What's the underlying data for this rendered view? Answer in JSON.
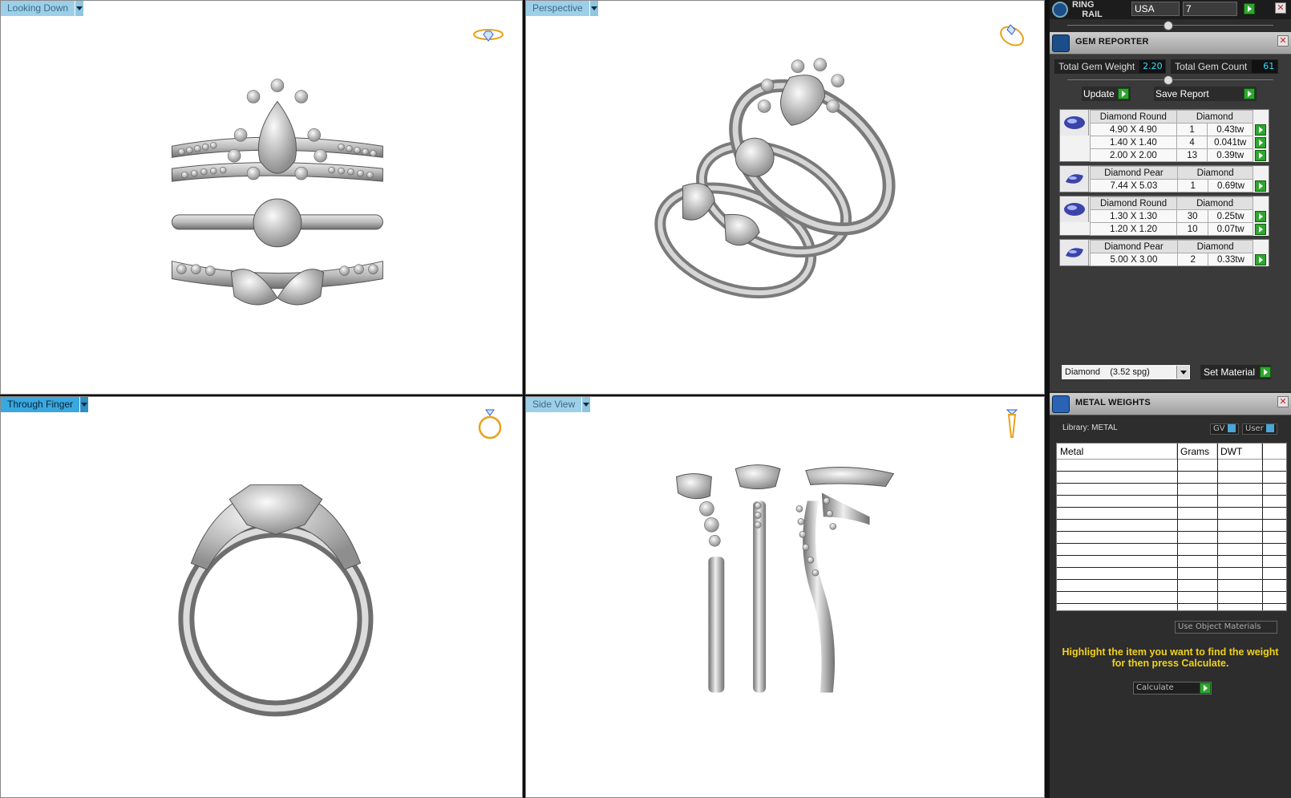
{
  "viewports": {
    "top_left": {
      "label": "Looking Down"
    },
    "top_right": {
      "label": "Perspective"
    },
    "bottom_left": {
      "label": "Through Finger"
    },
    "bottom_right": {
      "label": "Side View"
    }
  },
  "ring_rail": {
    "title_line1": "RING",
    "title_line2": "RAIL",
    "country": "USA",
    "size": "7"
  },
  "gem_reporter": {
    "title": "GEM REPORTER",
    "total_weight_label": "Total Gem Weight",
    "total_weight": "2.20",
    "total_count_label": "Total Gem Count",
    "total_count": "61",
    "update_label": "Update",
    "save_label": "Save Report",
    "groups": [
      {
        "shape": "Diamond Round",
        "material": "Diamond",
        "rows": [
          {
            "size": "4.90 X 4.90",
            "count": "1",
            "weight": "0.43tw"
          },
          {
            "size": "1.40 X 1.40",
            "count": "4",
            "weight": "0.041tw"
          },
          {
            "size": "2.00 X 2.00",
            "count": "13",
            "weight": "0.39tw"
          }
        ]
      },
      {
        "shape": "Diamond Pear",
        "material": "Diamond",
        "rows": [
          {
            "size": "7.44 X 5.03",
            "count": "1",
            "weight": "0.69tw"
          }
        ]
      },
      {
        "shape": "Diamond Round",
        "material": "Diamond",
        "rows": [
          {
            "size": "1.30 X 1.30",
            "count": "30",
            "weight": "0.25tw"
          },
          {
            "size": "1.20 X 1.20",
            "count": "10",
            "weight": "0.07tw"
          }
        ]
      },
      {
        "shape": "Diamond Pear",
        "material": "Diamond",
        "rows": [
          {
            "size": "5.00 X 3.00",
            "count": "2",
            "weight": "0.33tw"
          }
        ]
      }
    ],
    "material_select": "Diamond    (3.52 spg)",
    "set_material_label": "Set Material"
  },
  "metal_weights": {
    "title": "METAL WEIGHTS",
    "library": "Library: METAL",
    "gv": "GV",
    "user": "User",
    "columns": [
      "Metal",
      "Grams",
      "DWT"
    ],
    "use_object_materials": "Use Object Materials",
    "hint": "Highlight the item you want to find the weight for then press Calculate.",
    "calculate": "Calculate"
  },
  "colors": {
    "accent_blue": "#3aa7df",
    "go_green": "#2fa62f",
    "hint_yellow": "#f0d11b",
    "value_cyan": "#2ee0ff"
  }
}
